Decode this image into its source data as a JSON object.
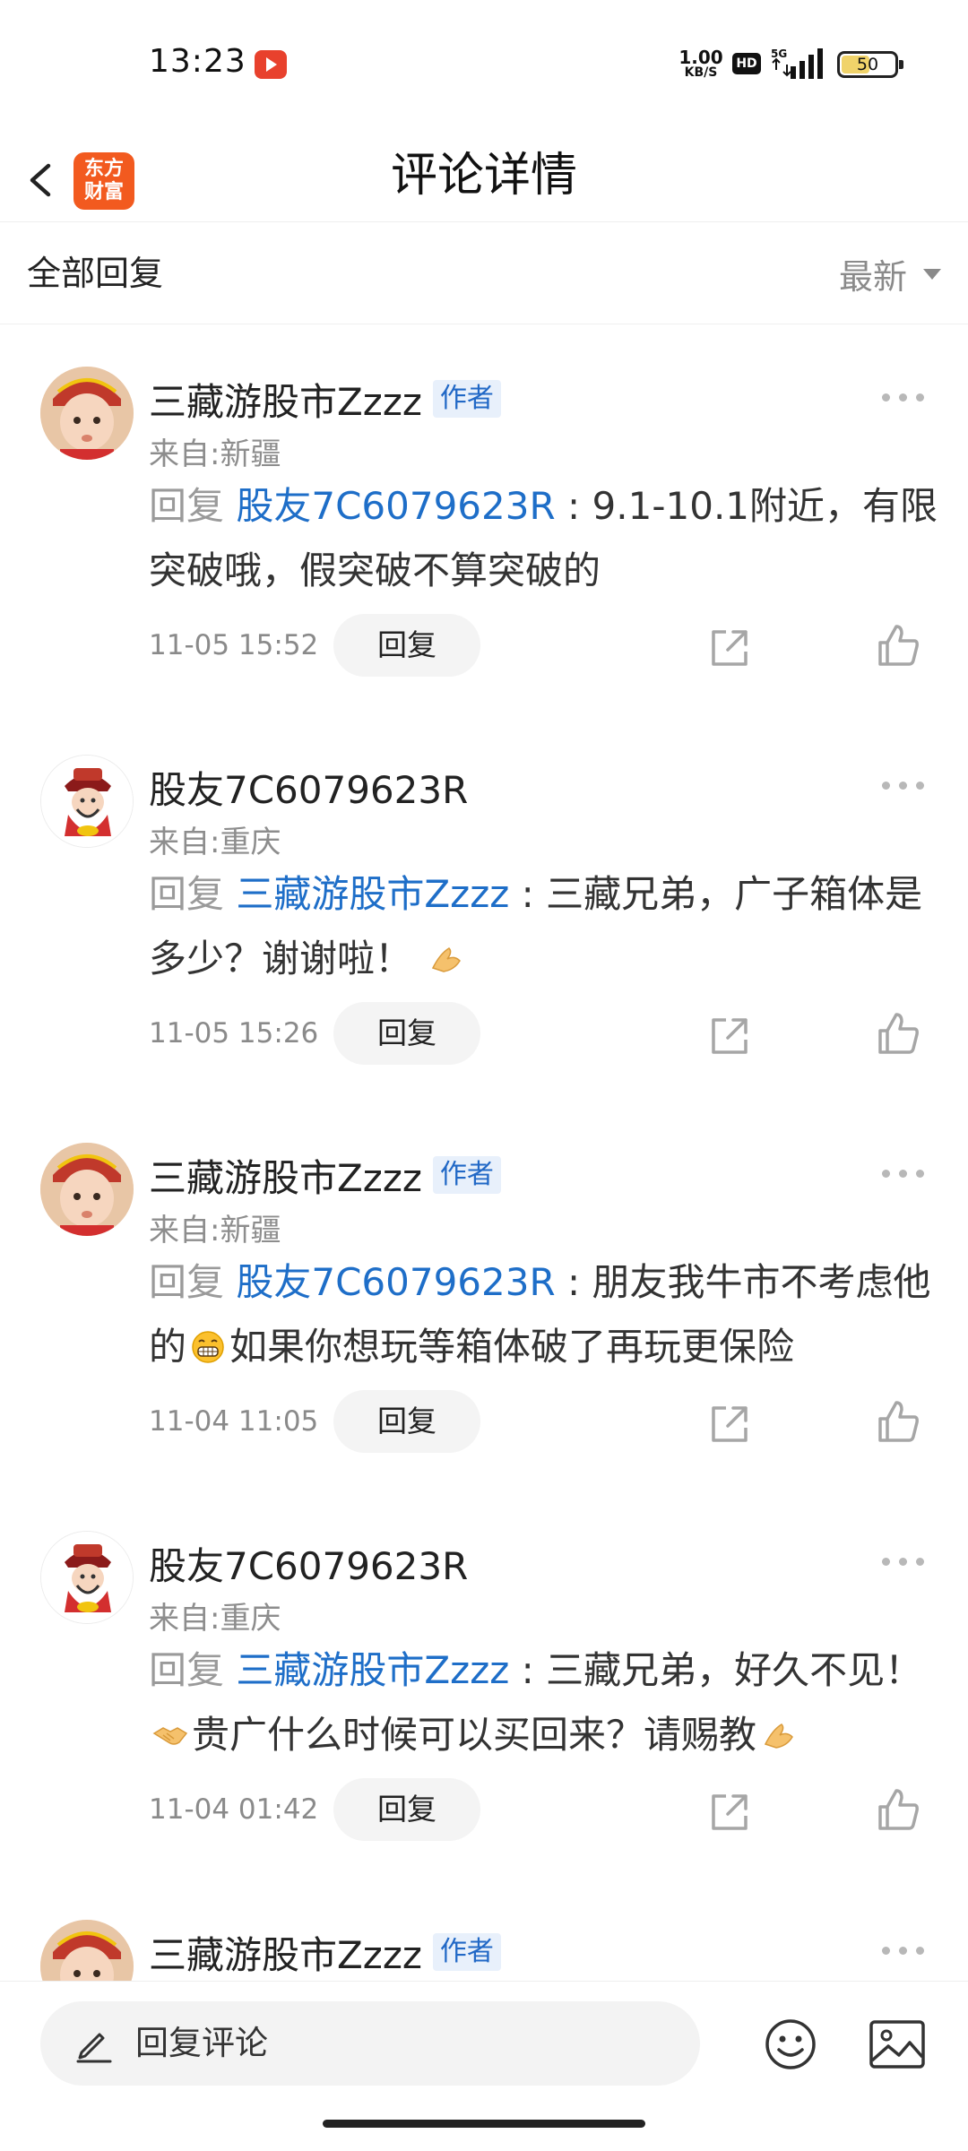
{
  "status_bar": {
    "time": "13:23",
    "net_speed_value": "1.00",
    "net_speed_unit": "KB/S",
    "hd_label": "HD",
    "network_type": "5G",
    "battery": "50"
  },
  "header": {
    "logo_line1": "东方",
    "logo_line2": "财富",
    "title": "评论详情"
  },
  "filter": {
    "label": "全部回复",
    "sort_label": "最新"
  },
  "reply_prefix": "回复",
  "reply_button_label": "回复",
  "comments": [
    {
      "username": "三藏游股市Zzzz",
      "author_badge": "作者",
      "location": "来自:新疆",
      "mention": "股友7C6079623R",
      "text": "9.1-10.1附近，有限突破哦，假突破不算突破的",
      "time": "11-05 15:52"
    },
    {
      "username": "股友7C6079623R",
      "location": "来自:重庆",
      "mention": "三藏游股市Zzzz",
      "text": "三藏兄弟，广子箱体是多少？谢谢啦！",
      "time": "11-05 15:26"
    },
    {
      "username": "三藏游股市Zzzz",
      "author_badge": "作者",
      "location": "来自:新疆",
      "mention": "股友7C6079623R",
      "text_before_emoji": "朋友我牛市不考虑他的",
      "text_after_emoji": "如果你想玩等箱体破了再玩更保险",
      "time": "11-04 11:05"
    },
    {
      "username": "股友7C6079623R",
      "location": "来自:重庆",
      "mention": "三藏游股市Zzzz",
      "text_before_emoji": "三藏兄弟，好久不见！",
      "text_after_emoji": "贵广什么时候可以买回来？请赐教",
      "time": "11-04 01:42"
    },
    {
      "username": "三藏游股市Zzzz",
      "author_badge": "作者"
    }
  ],
  "bottom_bar": {
    "placeholder": "回复评论"
  }
}
